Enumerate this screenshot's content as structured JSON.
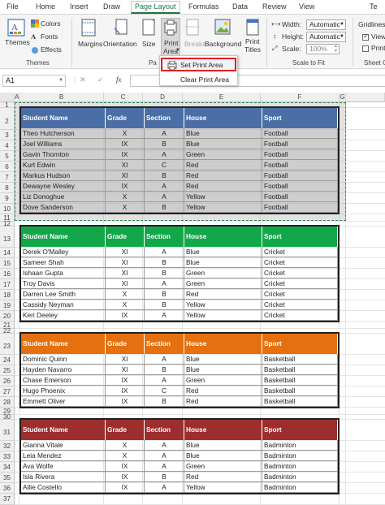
{
  "tabs": [
    "File",
    "Home",
    "Insert",
    "Draw",
    "Page Layout",
    "Formulas",
    "Data",
    "Review",
    "View",
    "Te"
  ],
  "ribbon": {
    "themes": {
      "themes_label": "Themes",
      "colors_label": "Colors",
      "fonts_label": "Fonts",
      "effects_label": "Effects",
      "group": "Themes"
    },
    "page_setup": {
      "margins": "Margins",
      "orientation": "Orientation",
      "size": "Size",
      "print_area": "Print",
      "print_area2": "Area",
      "breaks": "Breaks",
      "background": "Background",
      "print_titles": "Print",
      "print_titles2": "Titles",
      "group": "Pa"
    },
    "scale": {
      "width_label": "Width:",
      "width_value": "Automatic",
      "height_label": "Height:",
      "height_value": "Automatic",
      "scale_label": "Scale:",
      "scale_value": "100%",
      "group": "Scale to Fit"
    },
    "sheet_options": {
      "gridlines": "Gridlines",
      "view": "View",
      "print": "Print",
      "group": "Sheet O"
    }
  },
  "dropdown": {
    "items": [
      "Set Print Area",
      "Clear Print Area"
    ]
  },
  "formula_bar": {
    "name_box": "A1",
    "fx": "fx"
  },
  "columns": [
    "A",
    "B",
    "C",
    "D",
    "E",
    "F",
    "G"
  ],
  "colors": {
    "blue": "#4a6fa6",
    "green": "#12a84a",
    "orange": "#e5700f",
    "red": "#9c2e2e"
  },
  "tables": [
    {
      "header": [
        "Student Name",
        "Grade",
        "Section",
        "House",
        "Sport"
      ],
      "rows": [
        [
          "Theo Hutcherson",
          "X",
          "A",
          "Blue",
          "Football"
        ],
        [
          "Joel Williams",
          "IX",
          "B",
          "Blue",
          "Football"
        ],
        [
          "Gavin Thornton",
          "IX",
          "A",
          "Green",
          "Football"
        ],
        [
          "Kurt Edwin",
          "XI",
          "C",
          "Red",
          "Football"
        ],
        [
          "Markus Hudson",
          "XI",
          "B",
          "Red",
          "Football"
        ],
        [
          "Dewayne Wesley",
          "IX",
          "A",
          "Red",
          "Football"
        ],
        [
          "Liz Donoghue",
          "X",
          "A",
          "Yellow",
          "Football"
        ],
        [
          "Dove Sanderson",
          "X",
          "B",
          "Yellow",
          "Football"
        ]
      ]
    },
    {
      "header": [
        "Student Name",
        "Grade",
        "Section",
        "House",
        "Sport"
      ],
      "rows": [
        [
          "Derek O'Malley",
          "XI",
          "A",
          "Blue",
          "Cricket"
        ],
        [
          "Sameer Shah",
          "XI",
          "B",
          "Blue",
          "Cricket"
        ],
        [
          "Ishaan Gupta",
          "XI",
          "B",
          "Green",
          "Cricket"
        ],
        [
          "Troy Davis",
          "XI",
          "A",
          "Green",
          "Cricket"
        ],
        [
          "Darren Lee Smith",
          "X",
          "B",
          "Red",
          "Cricket"
        ],
        [
          "Cassidy Neyman",
          "X",
          "B",
          "Yellow",
          "Cricket"
        ],
        [
          "Keri Deeley",
          "IX",
          "A",
          "Yellow",
          "Cricket"
        ]
      ]
    },
    {
      "header": [
        "Student Name",
        "Grade",
        "Section",
        "House",
        "Sport"
      ],
      "rows": [
        [
          "Dominic Quinn",
          "XI",
          "A",
          "Blue",
          "Basketball"
        ],
        [
          "Hayden Navarro",
          "XI",
          "B",
          "Blue",
          "Basketball"
        ],
        [
          "Chase Emerson",
          "IX",
          "A",
          "Green",
          "Basketball"
        ],
        [
          "Hugo Phoenix",
          "IX",
          "C",
          "Red",
          "Basketball"
        ],
        [
          "Emmett Oliver",
          "IX",
          "B",
          "Red",
          "Basketball"
        ]
      ]
    },
    {
      "header": [
        "Student Name",
        "Grade",
        "Section",
        "House",
        "Sport"
      ],
      "rows": [
        [
          "Gianna Vitale",
          "X",
          "A",
          "Blue",
          "Badminton"
        ],
        [
          "Leia Mendez",
          "X",
          "A",
          "Blue",
          "Badminton"
        ],
        [
          "Ava Wolfe",
          "IX",
          "A",
          "Green",
          "Badminton"
        ],
        [
          "Isla Rivera",
          "IX",
          "B",
          "Red",
          "Badminton"
        ],
        [
          "Allie Costello",
          "IX",
          "A",
          "Yellow",
          "Badminton"
        ]
      ]
    }
  ]
}
